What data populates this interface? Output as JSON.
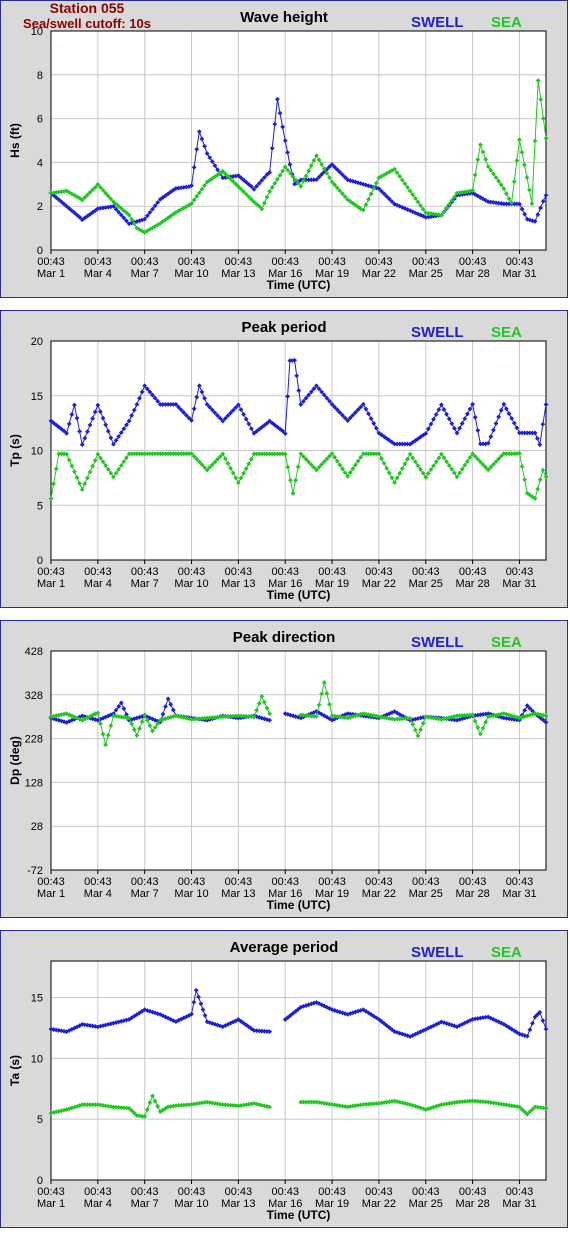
{
  "station": {
    "name": "Station 055",
    "cutoff": "Sea/swell cutoff: 10s"
  },
  "legend": {
    "swell": "SWELL",
    "sea": "SEA"
  },
  "colors": {
    "swell": "#1f1fd6",
    "sea": "#22c722",
    "title_station": "#8b0000",
    "frame": "#2a2a9a",
    "panel_bg": "#d9d9d9"
  },
  "chart_data": [
    {
      "type": "line",
      "title": "Wave height",
      "xlabel": "Time (UTC)",
      "ylabel": "Hs (ft)",
      "ylim": [
        0,
        10
      ],
      "yticks": [
        0,
        2,
        4,
        6,
        8,
        10
      ],
      "xlim": [
        0,
        31.7
      ],
      "xticks": [
        0,
        3,
        6,
        9,
        12,
        15,
        18,
        21,
        24,
        27,
        30
      ],
      "xtick_labels": [
        [
          "00:43",
          "Mar 1"
        ],
        [
          "00:43",
          "Mar 4"
        ],
        [
          "00:43",
          "Mar 7"
        ],
        [
          "00:43",
          "Mar 10"
        ],
        [
          "00:43",
          "Mar 13"
        ],
        [
          "00:43",
          "Mar 16"
        ],
        [
          "00:43",
          "Mar 19"
        ],
        [
          "00:43",
          "Mar 22"
        ],
        [
          "00:43",
          "Mar 25"
        ],
        [
          "00:43",
          "Mar 28"
        ],
        [
          "00:43",
          "Mar 31"
        ]
      ],
      "grid": true,
      "legend_position": "top-right",
      "series": [
        {
          "name": "SWELL",
          "x": [
            0,
            1,
            2,
            3,
            4,
            5,
            6,
            7,
            8,
            9,
            9.5,
            10,
            11,
            12,
            13,
            14,
            14.5,
            15,
            15.3,
            15.6,
            16,
            17,
            18,
            19,
            20,
            21,
            22,
            23,
            24,
            25,
            26,
            27,
            28,
            29,
            30,
            30.5,
            31,
            31.7
          ],
          "y": [
            2.6,
            2.0,
            1.4,
            1.9,
            2.0,
            1.2,
            1.4,
            2.3,
            2.8,
            2.9,
            5.4,
            4.4,
            3.3,
            3.4,
            2.8,
            3.6,
            6.9,
            5.0,
            3.9,
            3.0,
            3.2,
            3.2,
            3.9,
            3.2,
            3.0,
            2.8,
            2.1,
            1.8,
            1.5,
            1.6,
            2.5,
            2.6,
            2.2,
            2.1,
            2.1,
            1.4,
            1.3,
            2.5
          ]
        },
        {
          "name": "SEA",
          "x": [
            0,
            1,
            2,
            3,
            3.5,
            4,
            5,
            5.5,
            6,
            7,
            8,
            9,
            10,
            11,
            12,
            13,
            13.5,
            14,
            15,
            16,
            17,
            18,
            19,
            20,
            21,
            22,
            23,
            24,
            25,
            26,
            27,
            27.5,
            28,
            29,
            29.5,
            30,
            30.8,
            31.2,
            31.7
          ],
          "y": [
            2.6,
            2.7,
            2.3,
            3.0,
            2.6,
            2.2,
            1.6,
            1.0,
            0.8,
            1.2,
            1.7,
            2.1,
            3.1,
            3.6,
            2.9,
            2.2,
            1.9,
            2.7,
            3.8,
            2.9,
            4.3,
            3.1,
            2.3,
            1.8,
            3.3,
            3.7,
            2.7,
            1.7,
            1.6,
            2.6,
            2.7,
            4.8,
            3.8,
            2.8,
            2.1,
            5.0,
            2.2,
            7.7,
            5.1
          ]
        }
      ]
    },
    {
      "type": "line",
      "title": "Peak period",
      "xlabel": "Time (UTC)",
      "ylabel": "Tp (s)",
      "ylim": [
        0,
        20
      ],
      "yticks": [
        0,
        5,
        10,
        15,
        20
      ],
      "xlim": [
        0,
        31.7
      ],
      "xticks": [
        0,
        3,
        6,
        9,
        12,
        15,
        18,
        21,
        24,
        27,
        30
      ],
      "xtick_labels": [
        [
          "00:43",
          "Mar 1"
        ],
        [
          "00:43",
          "Mar 4"
        ],
        [
          "00:43",
          "Mar 7"
        ],
        [
          "00:43",
          "Mar 10"
        ],
        [
          "00:43",
          "Mar 13"
        ],
        [
          "00:43",
          "Mar 16"
        ],
        [
          "00:43",
          "Mar 19"
        ],
        [
          "00:43",
          "Mar 22"
        ],
        [
          "00:43",
          "Mar 25"
        ],
        [
          "00:43",
          "Mar 28"
        ],
        [
          "00:43",
          "Mar 31"
        ]
      ],
      "grid": true,
      "legend_position": "top-right",
      "series": [
        {
          "name": "SWELL",
          "x": [
            0,
            1,
            1.5,
            2,
            3,
            4,
            5,
            5.5,
            6,
            7,
            8,
            9,
            9.5,
            10,
            11,
            12,
            13,
            14,
            15,
            15.3,
            15.6,
            16,
            17,
            18,
            19,
            20,
            21,
            22,
            23,
            24,
            25,
            26,
            27,
            27.5,
            28,
            29,
            30,
            31,
            31.3,
            31.7
          ],
          "y": [
            12.7,
            11.6,
            14.2,
            10.6,
            14.2,
            10.6,
            12.7,
            14.2,
            15.9,
            14.2,
            14.2,
            12.7,
            15.9,
            14.2,
            12.7,
            14.2,
            11.6,
            12.7,
            11.6,
            18.2,
            18.2,
            14.2,
            15.9,
            14.2,
            12.7,
            14.2,
            11.6,
            10.6,
            10.6,
            11.6,
            14.2,
            11.6,
            14.2,
            10.6,
            10.6,
            14.2,
            11.6,
            11.6,
            10.6,
            14.2
          ]
        },
        {
          "name": "SEA",
          "x": [
            0,
            0.5,
            1,
            2,
            3,
            4,
            5,
            5.5,
            6,
            7,
            8,
            9,
            10,
            11,
            12,
            13,
            14,
            15,
            15.5,
            16,
            17,
            18,
            19,
            20,
            21,
            22,
            23,
            24,
            25,
            26,
            27,
            28,
            29,
            30,
            30.5,
            31,
            31.5,
            31.7
          ],
          "y": [
            5.6,
            9.7,
            9.7,
            6.5,
            9.7,
            7.6,
            9.7,
            9.7,
            9.7,
            9.7,
            9.7,
            9.7,
            8.2,
            9.7,
            7.1,
            9.7,
            9.7,
            9.7,
            6.1,
            9.7,
            8.2,
            9.7,
            7.6,
            9.7,
            9.7,
            7.1,
            9.7,
            7.6,
            9.7,
            7.6,
            9.7,
            8.2,
            9.7,
            9.7,
            6.1,
            5.6,
            8.2,
            7.6
          ]
        }
      ]
    },
    {
      "type": "line",
      "title": "Peak direction",
      "xlabel": "Time (UTC)",
      "ylabel": "Dp (deg)",
      "ylim": [
        -72,
        428
      ],
      "yticks": [
        -72,
        28,
        128,
        228,
        328,
        428
      ],
      "xlim": [
        0,
        31.7
      ],
      "xticks": [
        0,
        3,
        6,
        9,
        12,
        15,
        18,
        21,
        24,
        27,
        30
      ],
      "xtick_labels": [
        [
          "00:43",
          "Mar 1"
        ],
        [
          "00:43",
          "Mar 4"
        ],
        [
          "00:43",
          "Mar 7"
        ],
        [
          "00:43",
          "Mar 10"
        ],
        [
          "00:43",
          "Mar 13"
        ],
        [
          "00:43",
          "Mar 16"
        ],
        [
          "00:43",
          "Mar 19"
        ],
        [
          "00:43",
          "Mar 22"
        ],
        [
          "00:43",
          "Mar 25"
        ],
        [
          "00:43",
          "Mar 28"
        ],
        [
          "00:43",
          "Mar 31"
        ]
      ],
      "grid": true,
      "legend_position": "top-right",
      "series": [
        {
          "name": "SWELL",
          "x": [
            0,
            1,
            2,
            3,
            4,
            4.5,
            5,
            6,
            7,
            7.5,
            8,
            9,
            10,
            11,
            12,
            13,
            14,
            14.5,
            15,
            16,
            17,
            18,
            19,
            20,
            21,
            22,
            23,
            24,
            25,
            26,
            27,
            28,
            29,
            30,
            30.5,
            31,
            31.7
          ],
          "y": [
            275,
            265,
            280,
            270,
            285,
            310,
            270,
            280,
            265,
            318,
            280,
            275,
            270,
            280,
            275,
            280,
            270,
            null,
            285,
            275,
            290,
            270,
            285,
            280,
            275,
            290,
            270,
            278,
            275,
            270,
            280,
            285,
            275,
            270,
            303,
            285,
            265
          ]
        },
        {
          "name": "SEA",
          "x": [
            0,
            1,
            2,
            3,
            3.5,
            4,
            5,
            5.5,
            6,
            6.5,
            7,
            8,
            9,
            10,
            11,
            12,
            13,
            13.5,
            14,
            15,
            16,
            17,
            17.5,
            18,
            19,
            20,
            21,
            22,
            23,
            23.5,
            24,
            25,
            26,
            27,
            27.5,
            28,
            29,
            30,
            31,
            31.7
          ],
          "y": [
            278,
            285,
            270,
            288,
            215,
            280,
            275,
            235,
            282,
            245,
            270,
            280,
            272,
            275,
            278,
            280,
            278,
            325,
            285,
            null,
            282,
            278,
            355,
            280,
            275,
            285,
            278,
            272,
            275,
            235,
            278,
            272,
            280,
            282,
            238,
            278,
            285,
            275,
            285,
            280
          ]
        }
      ]
    },
    {
      "type": "line",
      "title": "Average period",
      "xlabel": "Time (UTC)",
      "ylabel": "Ta (s)",
      "ylim": [
        0,
        18
      ],
      "yticks": [
        0,
        5,
        10,
        15
      ],
      "xlim": [
        0,
        31.7
      ],
      "xticks": [
        0,
        3,
        6,
        9,
        12,
        15,
        18,
        21,
        24,
        27,
        30
      ],
      "xtick_labels": [
        [
          "00:43",
          "Mar 1"
        ],
        [
          "00:43",
          "Mar 4"
        ],
        [
          "00:43",
          "Mar 7"
        ],
        [
          "00:43",
          "Mar 10"
        ],
        [
          "00:43",
          "Mar 13"
        ],
        [
          "00:43",
          "Mar 16"
        ],
        [
          "00:43",
          "Mar 19"
        ],
        [
          "00:43",
          "Mar 22"
        ],
        [
          "00:43",
          "Mar 25"
        ],
        [
          "00:43",
          "Mar 28"
        ],
        [
          "00:43",
          "Mar 31"
        ]
      ],
      "grid": true,
      "legend_position": "top-right",
      "series": [
        {
          "name": "SWELL",
          "x": [
            0,
            1,
            2,
            3,
            4,
            5,
            6,
            7,
            8,
            9,
            9.3,
            9.6,
            10,
            11,
            12,
            13,
            14,
            14.5,
            15,
            16,
            17,
            18,
            19,
            20,
            21,
            22,
            23,
            24,
            25,
            26,
            27,
            28,
            29,
            30,
            30.5,
            31,
            31.3,
            31.7
          ],
          "y": [
            12.4,
            12.2,
            12.8,
            12.6,
            12.9,
            13.2,
            14.0,
            13.6,
            13.0,
            13.6,
            15.6,
            14.5,
            13.0,
            12.6,
            13.2,
            12.3,
            12.2,
            null,
            13.2,
            14.2,
            14.6,
            14.0,
            13.6,
            14.0,
            13.2,
            12.2,
            11.8,
            12.4,
            13.0,
            12.6,
            13.2,
            13.4,
            12.8,
            12.0,
            11.8,
            13.4,
            13.8,
            12.4
          ]
        },
        {
          "name": "SEA",
          "x": [
            0,
            1,
            2,
            3,
            4,
            5,
            5.5,
            6,
            6.5,
            7,
            7.5,
            8,
            9,
            10,
            11,
            12,
            13,
            14,
            15,
            16,
            17,
            18,
            19,
            20,
            21,
            22,
            23,
            24,
            25,
            26,
            27,
            28,
            29,
            30,
            30.5,
            31,
            31.7
          ],
          "y": [
            5.5,
            5.8,
            6.2,
            6.2,
            6.0,
            5.9,
            5.3,
            5.2,
            6.9,
            5.6,
            6.0,
            6.1,
            6.2,
            6.4,
            6.2,
            6.1,
            6.3,
            6.0,
            null,
            6.4,
            6.4,
            6.2,
            6.0,
            6.2,
            6.3,
            6.5,
            6.2,
            5.8,
            6.2,
            6.4,
            6.5,
            6.4,
            6.2,
            6.0,
            5.4,
            6.0,
            5.9
          ]
        }
      ]
    }
  ]
}
